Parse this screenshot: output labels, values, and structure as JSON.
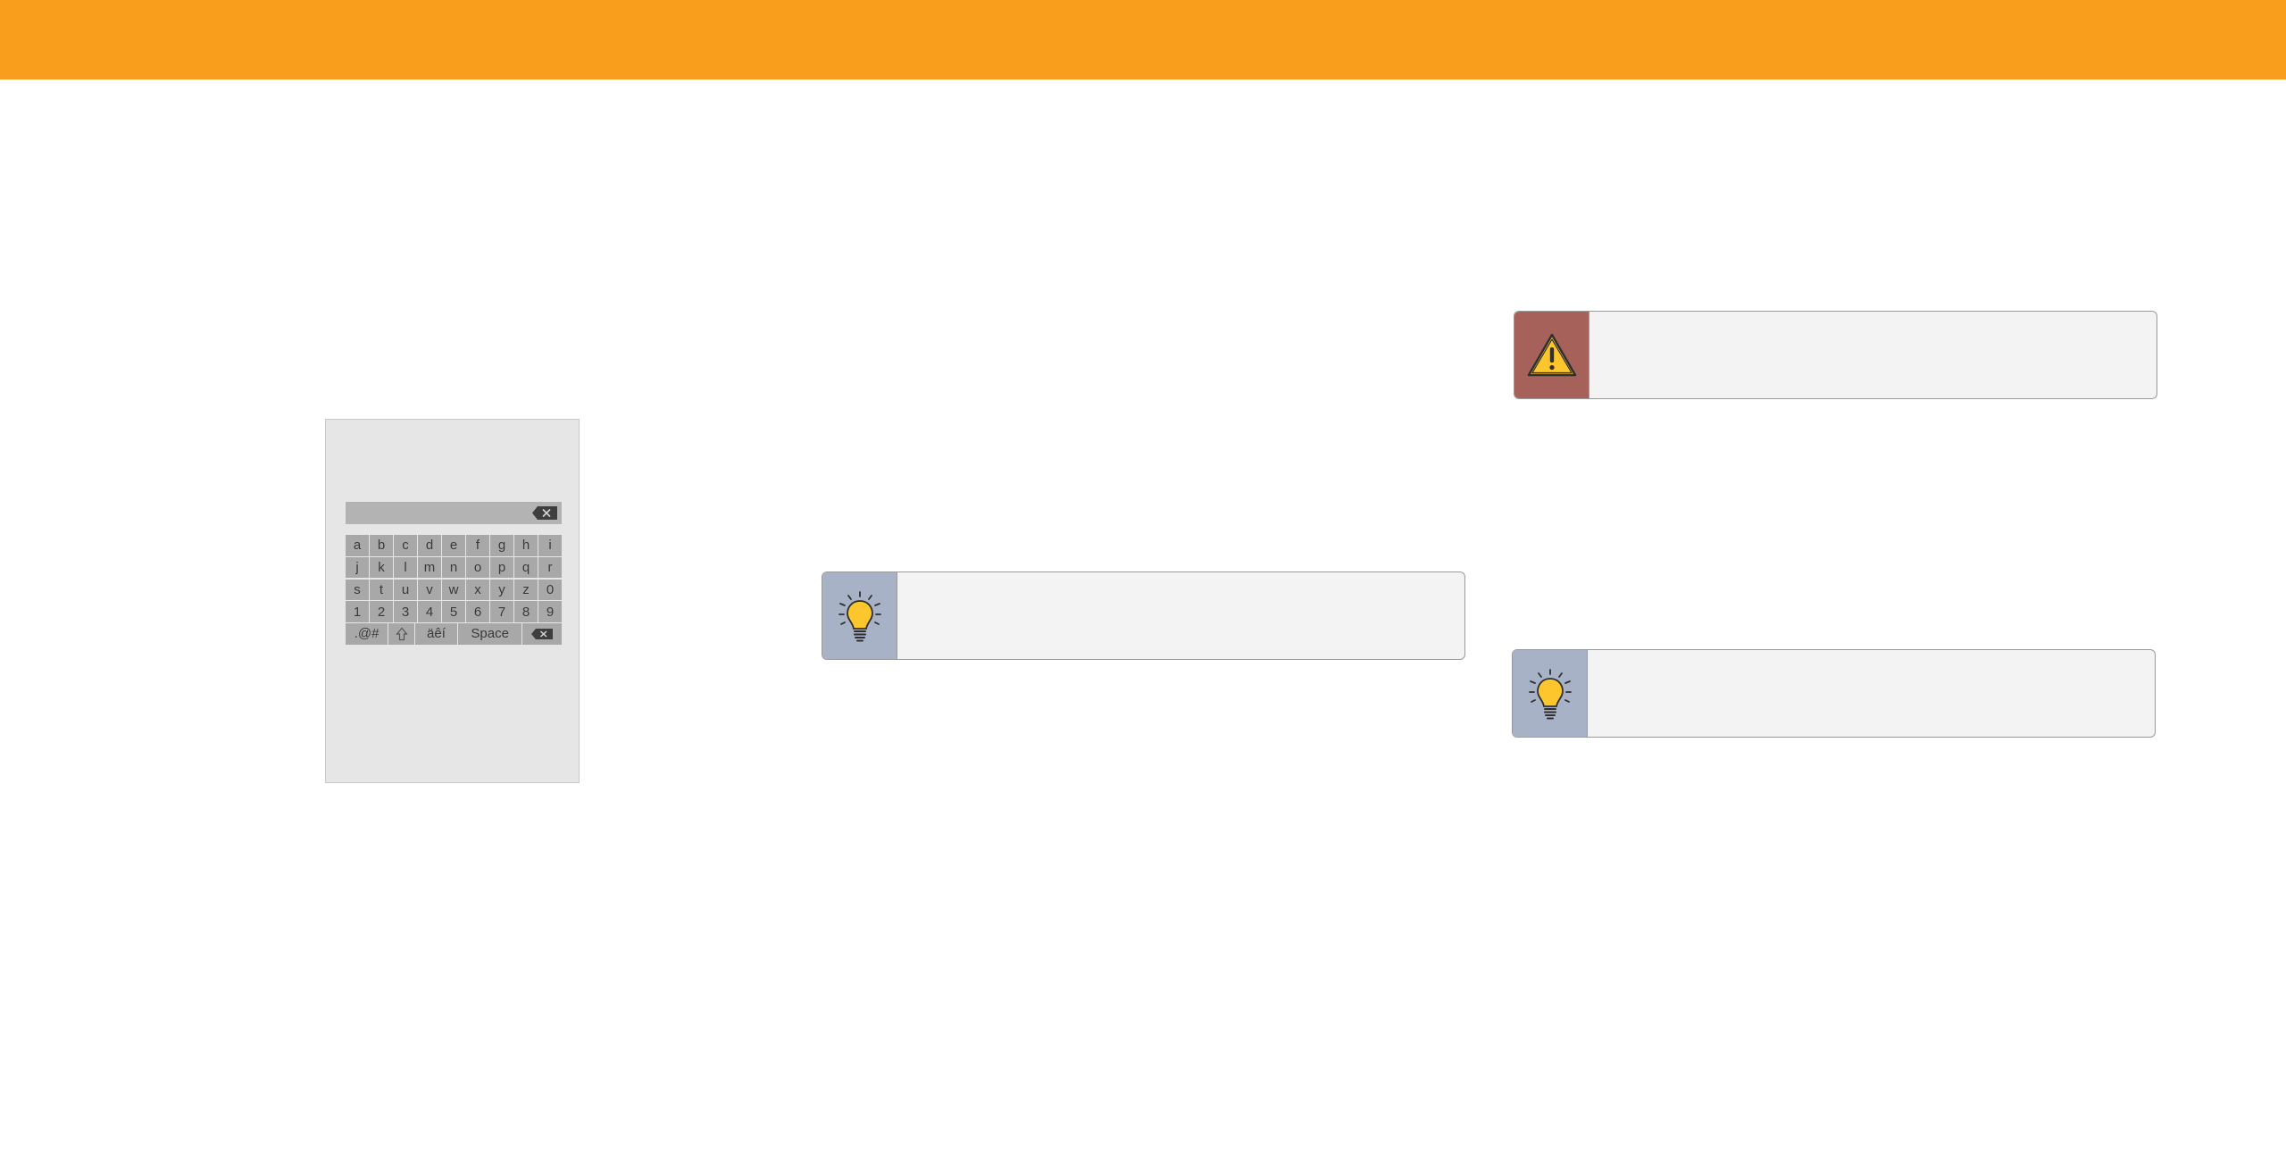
{
  "keyboard": {
    "rows": [
      [
        "a",
        "b",
        "c",
        "d",
        "e",
        "f",
        "g",
        "h",
        "i"
      ],
      [
        "j",
        "k",
        "l",
        "m",
        "n",
        "o",
        "p",
        "q",
        "r"
      ],
      [
        "s",
        "t",
        "u",
        "v",
        "w",
        "x",
        "y",
        "z",
        "0"
      ],
      [
        "1",
        "2",
        "3",
        "4",
        "5",
        "6",
        "7",
        "8",
        "9"
      ]
    ],
    "symbols_label": ".@#",
    "accents_label": "äêí",
    "space_label": "Space",
    "shift_icon": "shift-arrow-icon",
    "backspace_icon": "backspace-icon",
    "clear_icon": "clear-input-icon"
  },
  "callouts": [
    {
      "kind": "tip",
      "icon": "lightbulb-icon",
      "text": ""
    },
    {
      "kind": "warning",
      "icon": "warning-icon",
      "text": ""
    },
    {
      "kind": "tip",
      "icon": "lightbulb-icon",
      "text": ""
    }
  ],
  "colors": {
    "header_bar": "#f99d1c",
    "tip_accent": "#a7b2c6",
    "warning_accent": "#a6625a",
    "icon_yellow": "#fcc62c"
  }
}
